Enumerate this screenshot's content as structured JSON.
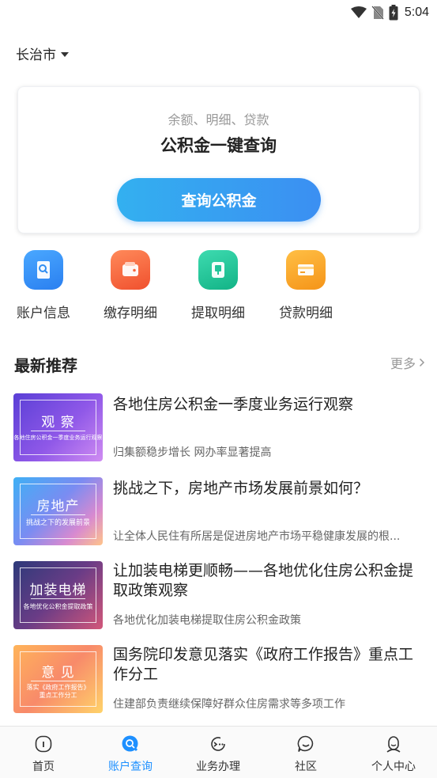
{
  "status_bar": {
    "time": "5:04",
    "icons": [
      "wifi-icon",
      "no-sim-icon",
      "battery-charging-icon"
    ]
  },
  "header": {
    "city": "长治市"
  },
  "query_card": {
    "subtitle": "余额、明细、贷款",
    "title": "公积金一键查询",
    "button_label": "查询公积金"
  },
  "quick_actions": [
    {
      "label": "账户信息",
      "icon": "account-search-icon",
      "color": "#2f8ef2"
    },
    {
      "label": "缴存明细",
      "icon": "wallet-icon",
      "color": "#f5663c"
    },
    {
      "label": "提取明细",
      "icon": "withdraw-icon",
      "color": "#22c49a"
    },
    {
      "label": "贷款明细",
      "icon": "card-icon",
      "color": "#f5a12a"
    }
  ],
  "recommend": {
    "title": "最新推荐",
    "more": "更多"
  },
  "news": [
    {
      "title": "各地住房公积金一季度业务运行观察",
      "summary": "归集额稳步增长 网办率显著提高",
      "thumb_title": "观 察",
      "thumb_sub": "各地住房公积金一季度业务运行观察"
    },
    {
      "title": "挑战之下，房地产市场发展前景如何？",
      "summary": " 让全体人民住有所居是促进房地产市场平稳健康发展的根...",
      "thumb_title": "房地产",
      "thumb_sub": "挑战之下的发展前景"
    },
    {
      "title": "让加装电梯更顺畅——各地优化住房公积金提取政策观察",
      "summary": "各地优化加装电梯提取住房公积金政策",
      "thumb_title": "加装电梯",
      "thumb_sub": "各地优化公积金提取政策"
    },
    {
      "title": "国务院印发意见落实《政府工作报告》重点工作分工",
      "summary": "住建部负责继续保障好群众住房需求等多项工作",
      "thumb_title": "意 见",
      "thumb_sub": "落实《政府工作报告》\n重点工作分工"
    }
  ],
  "tabs": [
    {
      "label": "首页",
      "icon": "home-icon",
      "active": false
    },
    {
      "label": "账户查询",
      "icon": "account-query-icon",
      "active": true
    },
    {
      "label": "业务办理",
      "icon": "business-icon",
      "active": false
    },
    {
      "label": "社区",
      "icon": "community-icon",
      "active": false
    },
    {
      "label": "个人中心",
      "icon": "profile-icon",
      "active": false
    }
  ],
  "colors": {
    "accent": "#1e90ff",
    "button_start": "#33b0f0",
    "button_end": "#3b8ff2"
  }
}
